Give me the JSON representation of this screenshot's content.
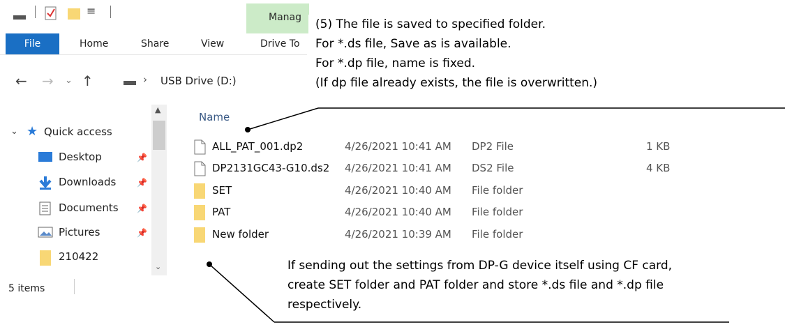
{
  "quick_access_toolbar": {
    "dropdown_glyph": "≡"
  },
  "ribbon": {
    "tabs": [
      "File",
      "Home",
      "Share",
      "View",
      "Drive To"
    ],
    "contextual_tab": "Manag"
  },
  "address_bar": {
    "path_text": "USB Drive (D:)"
  },
  "nav_pane": {
    "quick_access": "Quick access",
    "items": [
      "Desktop",
      "Downloads",
      "Documents",
      "Pictures",
      "210422"
    ]
  },
  "file_list": {
    "column_header": "Name",
    "rows": [
      {
        "name": "ALL_PAT_001.dp2",
        "date": "4/26/2021 10:41 AM",
        "type": "DP2 File",
        "size": "1 KB",
        "kind": "file"
      },
      {
        "name": "DP2131GC43-G10.ds2",
        "date": "4/26/2021 10:41 AM",
        "type": "DS2 File",
        "size": "4 KB",
        "kind": "file"
      },
      {
        "name": "SET",
        "date": "4/26/2021 10:40 AM",
        "type": "File folder",
        "size": "",
        "kind": "folder"
      },
      {
        "name": "PAT",
        "date": "4/26/2021 10:40 AM",
        "type": "File folder",
        "size": "",
        "kind": "folder"
      },
      {
        "name": "New folder",
        "date": "4/26/2021 10:39 AM",
        "type": "File folder",
        "size": "",
        "kind": "folder"
      }
    ]
  },
  "status_bar": {
    "item_count": "5 items"
  },
  "annotation_top": [
    "(5) The file is saved to specified folder.",
    "For *.ds file, Save as is available.",
    "For *.dp file, name is fixed.",
    "(If dp file already exists, the file is overwritten.)"
  ],
  "annotation_bottom": [
    "If sending out the settings from DP-G device itself using CF card,",
    "create SET folder and PAT folder and store *.ds file and *.dp file",
    "respectively."
  ],
  "colors": {
    "file_tab": "#1a6fc4",
    "manage_tab": "#ccebc8",
    "folder": "#f8d775",
    "accent_blue": "#2a7bd8"
  }
}
